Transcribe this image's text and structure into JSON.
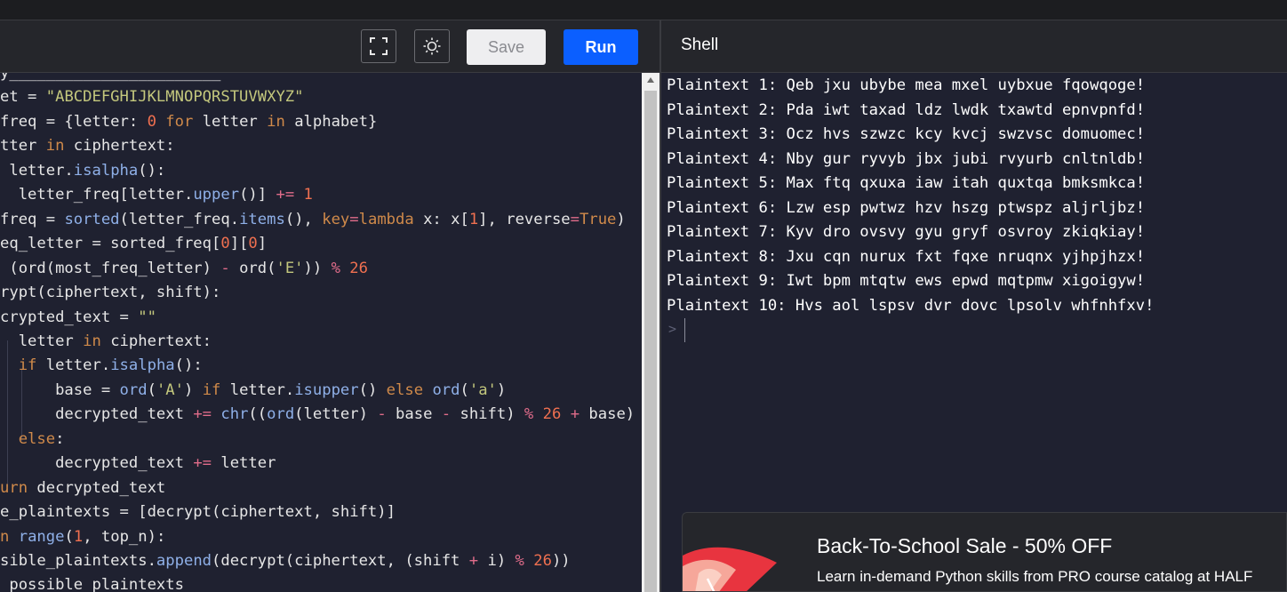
{
  "toolbar": {
    "fullscreen_icon": "fullscreen-icon",
    "theme_icon": "sun-icon",
    "save_label": "Save",
    "run_label": "Run"
  },
  "shell": {
    "title": "Shell",
    "output": [
      "Plaintext 1: Qeb jxu ubybe mea mxel uybxue fqowqoge!",
      "Plaintext 2: Pda iwt taxad ldz lwdk txawtd epnvpnfd!",
      "Plaintext 3: Ocz hvs szwzc kcy kvcj swzvsc domuomec!",
      "Plaintext 4: Nby gur ryvyb jbx jubi rvyurb cnltnldb!",
      "Plaintext 5: Max ftq qxuxa iaw itah quxtqa bmksmkca!",
      "Plaintext 6: Lzw esp pwtwz hzv hszg ptwspz aljrljbz!",
      "Plaintext 7: Kyv dro ovsvy gyu gryf osvroy zkiqkiay!",
      "Plaintext 8: Jxu cqn nurux fxt fqxe nruqnx yjhpjhzx!",
      "Plaintext 9: Iwt bpm mtqtw ews epwd mqtpmw xigoigyw!",
      "Plaintext 10: Hvs aol lspsv dvr dovc lpsolv whfnhfxv!"
    ],
    "prompt": ">"
  },
  "ad": {
    "title": "Back-To-School Sale - 50% OFF",
    "subtitle": "Learn in-demand Python skills from PRO course catalog at HALF"
  },
  "colors": {
    "run_button": "#0b5fff",
    "editor_bg": "#1f2130",
    "keyword": "#d08a4a",
    "function": "#8fb0e8",
    "string": "#c3c77d",
    "number": "#f07050",
    "operator": "#e06c8a"
  },
  "code": {
    "lines": [
      [
        [
          "",
          "y_______________________"
        ]
      ],
      [
        [
          "",
          "et = "
        ],
        [
          "s",
          "\"ABCDEFGHIJKLMNOPQRSTUVWXYZ\""
        ]
      ],
      [
        [
          "",
          "freq = {letter: "
        ],
        [
          "n",
          "0"
        ],
        [
          "",
          " "
        ],
        [
          "k",
          "for"
        ],
        [
          "",
          " letter "
        ],
        [
          "k",
          "in"
        ],
        [
          "",
          " alphabet}"
        ]
      ],
      [
        [
          "",
          "tter "
        ],
        [
          "k",
          "in"
        ],
        [
          "",
          " ciphertext:"
        ]
      ],
      [
        [
          "",
          " letter."
        ],
        [
          "f",
          "isalpha"
        ],
        [
          "",
          "():"
        ]
      ],
      [
        [
          "",
          "  letter_freq[letter."
        ],
        [
          "f",
          "upper"
        ],
        [
          "",
          "()] "
        ],
        [
          "o",
          "+="
        ],
        [
          "",
          " "
        ],
        [
          "n",
          "1"
        ]
      ],
      [
        [
          "",
          "freq = "
        ],
        [
          "f",
          "sorted"
        ],
        [
          "",
          "(letter_freq."
        ],
        [
          "f",
          "items"
        ],
        [
          "",
          "(), "
        ],
        [
          "k",
          "key"
        ],
        [
          "o",
          "="
        ],
        [
          "k",
          "lambda"
        ],
        [
          "",
          " x: x["
        ],
        [
          "n",
          "1"
        ],
        [
          "",
          "], reverse"
        ],
        [
          "o",
          "="
        ],
        [
          "k",
          "True"
        ],
        [
          "",
          ")"
        ]
      ],
      [
        [
          "",
          "eq_letter = sorted_freq["
        ],
        [
          "n",
          "0"
        ],
        [
          "",
          "]["
        ],
        [
          "n",
          "0"
        ],
        [
          "",
          "]"
        ]
      ],
      [
        [
          "",
          " (ord(most_freq_letter) "
        ],
        [
          "o",
          "-"
        ],
        [
          "",
          " ord("
        ],
        [
          "s",
          "'E'"
        ],
        [
          "",
          ")) "
        ],
        [
          "o",
          "%"
        ],
        [
          "",
          " "
        ],
        [
          "n",
          "26"
        ]
      ],
      [
        [
          "",
          "rypt(ciphertext, shift):"
        ]
      ],
      [
        [
          "",
          "crypted_text = "
        ],
        [
          "s",
          "\"\""
        ]
      ],
      [
        [
          "",
          "  letter "
        ],
        [
          "k",
          "in"
        ],
        [
          "",
          " ciphertext:"
        ]
      ],
      [
        [
          "",
          "  "
        ],
        [
          "k",
          "if"
        ],
        [
          "",
          " letter."
        ],
        [
          "f",
          "isalpha"
        ],
        [
          "",
          "():"
        ]
      ],
      [
        [
          "",
          "      base = "
        ],
        [
          "f",
          "ord"
        ],
        [
          "",
          "("
        ],
        [
          "s",
          "'A'"
        ],
        [
          "",
          ") "
        ],
        [
          "k",
          "if"
        ],
        [
          "",
          " letter."
        ],
        [
          "f",
          "isupper"
        ],
        [
          "",
          "() "
        ],
        [
          "k",
          "else"
        ],
        [
          "",
          " "
        ],
        [
          "f",
          "ord"
        ],
        [
          "",
          "("
        ],
        [
          "s",
          "'a'"
        ],
        [
          "",
          ")"
        ]
      ],
      [
        [
          "",
          "      decrypted_text "
        ],
        [
          "o",
          "+="
        ],
        [
          "",
          " "
        ],
        [
          "f",
          "chr"
        ],
        [
          "",
          "(("
        ],
        [
          "f",
          "ord"
        ],
        [
          "",
          "(letter) "
        ],
        [
          "o",
          "-"
        ],
        [
          "",
          " base "
        ],
        [
          "o",
          "-"
        ],
        [
          "",
          " shift) "
        ],
        [
          "o",
          "%"
        ],
        [
          "",
          " "
        ],
        [
          "n",
          "26"
        ],
        [
          "",
          " "
        ],
        [
          "o",
          "+"
        ],
        [
          "",
          " base)"
        ]
      ],
      [
        [
          "",
          "  "
        ],
        [
          "k",
          "else"
        ],
        [
          "",
          ":"
        ]
      ],
      [
        [
          "",
          "      decrypted_text "
        ],
        [
          "o",
          "+="
        ],
        [
          "",
          " letter"
        ]
      ],
      [
        [
          "k",
          "urn"
        ],
        [
          "",
          " decrypted_text"
        ]
      ],
      [
        [
          "",
          "e_plaintexts = [decrypt(ciphertext, shift)]"
        ]
      ],
      [
        [
          "k",
          "n"
        ],
        [
          "",
          " "
        ],
        [
          "f",
          "range"
        ],
        [
          "",
          "("
        ],
        [
          "n",
          "1"
        ],
        [
          "",
          ", top_n):"
        ]
      ],
      [
        [
          "",
          "sible_plaintexts."
        ],
        [
          "f",
          "append"
        ],
        [
          "",
          "(decrypt(ciphertext, (shift "
        ],
        [
          "o",
          "+"
        ],
        [
          "",
          " i) "
        ],
        [
          "o",
          "%"
        ],
        [
          "",
          " "
        ],
        [
          "n",
          "26"
        ],
        [
          "",
          "))"
        ]
      ],
      [
        [
          "",
          " possible_plaintexts"
        ]
      ]
    ]
  }
}
